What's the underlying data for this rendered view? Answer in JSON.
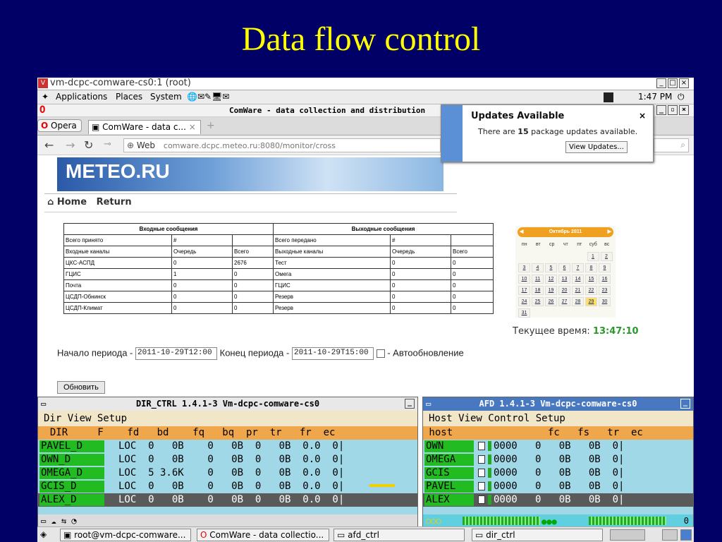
{
  "slide": {
    "title": "Data flow control"
  },
  "vm_window": {
    "title": "vm-dcpc-comware-cs0:1 (root)"
  },
  "panel": {
    "applications": "Applications",
    "places": "Places",
    "system": "System",
    "clock": "1:47 PM"
  },
  "opera": {
    "window_title": "ComWare - data collection and distribution",
    "menu_button": "Opera",
    "tab_label": "ComWare - data c...",
    "tab_close": "×",
    "url_scheme_label": "Web",
    "url": "comware.dcpc.meteo.ru:8080/monitor/cross"
  },
  "updates_popup": {
    "title": "Updates Available",
    "close": "×",
    "text_before": "There are ",
    "count": "15",
    "text_after": " package updates available.",
    "button": "View Updates..."
  },
  "page": {
    "banner": "METEO.RU",
    "nav": {
      "home": "Home",
      "return": "Return"
    },
    "incoming": {
      "header": "Входные сообщения",
      "total_label": "Всего принято",
      "total_value": "#",
      "col_channels": "Входные каналы",
      "col_queue": "Очередь",
      "col_total": "Всего",
      "rows": [
        {
          "name": "ЦКС-АСПД",
          "queue": "0",
          "total": "2676"
        },
        {
          "name": "ГЦИС",
          "queue": "1",
          "total": "0"
        },
        {
          "name": "Почта",
          "queue": "0",
          "total": "0"
        },
        {
          "name": "ЦСДП-Обнинск",
          "queue": "0",
          "total": "0"
        },
        {
          "name": "ЦСДП-Климат",
          "queue": "0",
          "total": "0"
        }
      ]
    },
    "outgoing": {
      "header": "Выходные сообщения",
      "total_label": "Всего передано",
      "total_value": "#",
      "col_channels": "Выходные каналы",
      "col_queue": "Очередь",
      "col_total": "Всего",
      "rows": [
        {
          "name": "Тест",
          "queue": "0",
          "total": "0"
        },
        {
          "name": "Омега",
          "queue": "0",
          "total": "0"
        },
        {
          "name": "ГЦИС",
          "queue": "0",
          "total": "0"
        },
        {
          "name": "Резерв",
          "queue": "0",
          "total": "0"
        },
        {
          "name": "Резерв",
          "queue": "0",
          "total": "0"
        }
      ]
    },
    "calendar": {
      "month": "Октябрь 2011",
      "weekdays": [
        "пн",
        "вт",
        "ср",
        "чт",
        "пт",
        "суб",
        "вс"
      ],
      "weeks": [
        [
          "",
          "",
          "",
          "",
          "",
          "1",
          "2"
        ],
        [
          "3",
          "4",
          "5",
          "6",
          "7",
          "8",
          "9"
        ],
        [
          "10",
          "11",
          "12",
          "13",
          "14",
          "15",
          "16"
        ],
        [
          "17",
          "18",
          "19",
          "20",
          "21",
          "22",
          "23"
        ],
        [
          "24",
          "25",
          "26",
          "27",
          "28",
          "29",
          "30"
        ],
        [
          "31",
          "",
          "",
          "",
          "",
          "",
          ""
        ]
      ],
      "selected": "29"
    },
    "current_time_label": "Текущее время:",
    "current_time": "13:47:10",
    "period_start_label": "Начало периода -",
    "period_start": "2011-10-29T12:00",
    "period_end_label": "Конец периода -",
    "period_end": "2011-10-29T15:00",
    "autoupdate_label": "- Автообновление",
    "refresh_button": "Обновить"
  },
  "dir_ctrl": {
    "title": "DIR_CTRL 1.4.1-3 Vm-dcpc-comware-cs0",
    "menu": "Dir  View  Setup",
    "header": "  DIR     F    fd   bd    fq   bq  pr  tr   fr  ec",
    "rows": [
      {
        "name": "PAVEL_D",
        "rest": "LOC  0   0B    0   0B  0   0B  0.0  0|"
      },
      {
        "name": "OWN_D",
        "rest": "LOC  0   0B    0   0B  0   0B  0.0  0|"
      },
      {
        "name": "OMEGA_D",
        "rest": "LOC  5 3.6K    0   0B  0   0B  0.0  0|"
      },
      {
        "name": "GCIS_D",
        "rest": "LOC  0   0B    0   0B  0   0B  0.0  0|"
      },
      {
        "name": "ALEX_D",
        "rest": "LOC  0   0B    0   0B  0   0B  0.0  0|"
      }
    ]
  },
  "afd": {
    "title": "AFD 1.4.1-3 Vm-dcpc-comware-cs0",
    "menu": "Host  View  Control  Setup",
    "header": " host                fc   fs   tr  ec",
    "rows": [
      {
        "name": "OWN",
        "rest": "0000   0   0B   0B  0|"
      },
      {
        "name": "OMEGA",
        "rest": "0000   0   0B   0B  0|"
      },
      {
        "name": "GCIS",
        "rest": "0000   0   0B   0B  0|"
      },
      {
        "name": "PAVEL",
        "rest": "0000   0   0B   0B  0|"
      },
      {
        "name": "ALEX",
        "rest": "0000   0   0B   0B  0|"
      }
    ],
    "status_right": "0"
  },
  "taskbar": {
    "items": [
      "root@vm-dcpc-comware...",
      "ComWare - data collectio...",
      "afd_ctrl",
      "dir_ctrl"
    ]
  }
}
